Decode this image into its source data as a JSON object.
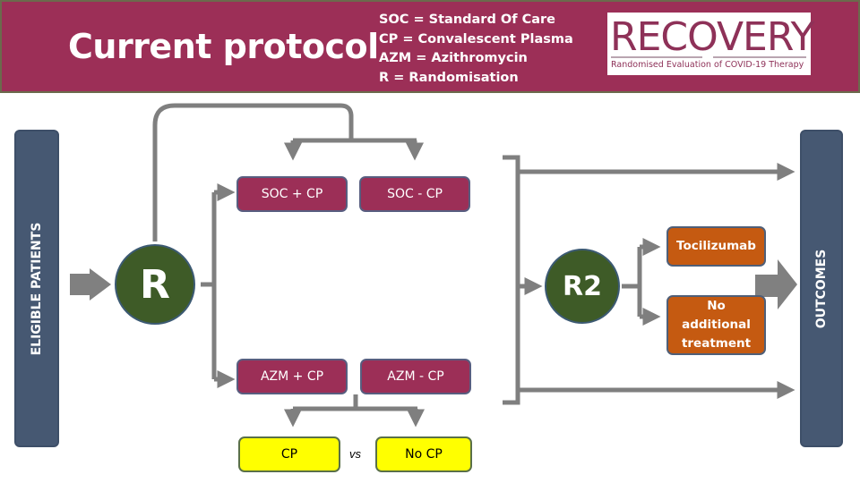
{
  "header": {
    "title": "Current protocol",
    "legend": [
      "SOC = Standard Of Care",
      "CP = Convalescent Plasma",
      "AZM = Azithromycin",
      "R = Randomisation"
    ],
    "logo": {
      "word": "RECOVERY",
      "subtitle": "Randomised Evaluation of COVID-19 Therapy"
    }
  },
  "diagram": {
    "eligible_label": "ELIGIBLE PATIENTS",
    "outcomes_label": "OUTCOMES",
    "randomisation_1": "R",
    "randomisation_2": "R2",
    "arms": {
      "soc_cp": "SOC + CP",
      "soc_no_cp": "SOC - CP",
      "azm_cp": "AZM + CP",
      "azm_no_cp": "AZM - CP"
    },
    "comparison": {
      "left": "CP",
      "vs": "vs",
      "right": "No CP"
    },
    "second_randomisation": {
      "option_a": "Tocilizumab",
      "option_b": "No additional treatment"
    }
  },
  "colors": {
    "header_bg": "#9c2f57",
    "arm_box": "#9c2f57",
    "side_bar": "#465872",
    "circle": "#3e5b27",
    "treatment_box": "#c55a11",
    "comparison_box": "#ffff00",
    "connector": "#7f7f7f"
  }
}
